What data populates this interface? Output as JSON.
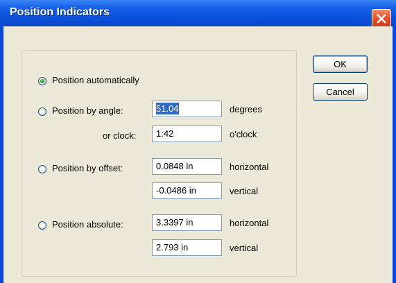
{
  "window": {
    "title": "Position Indicators",
    "close_icon": "close-icon"
  },
  "buttons": {
    "ok": "OK",
    "cancel": "Cancel"
  },
  "options": {
    "auto": {
      "label": "Position automatically",
      "selected": true
    },
    "angle": {
      "label": "Position by angle:",
      "angle_value": "51.04",
      "angle_unit": "degrees",
      "clock_label": "or clock:",
      "clock_value": "1:42",
      "clock_unit": "o'clock"
    },
    "offset": {
      "label": "Position by offset:",
      "horizontal_value": "0.0848 in",
      "horizontal_unit": "horizontal",
      "vertical_value": "-0.0486 in",
      "vertical_unit": "vertical"
    },
    "absolute": {
      "label": "Position absolute:",
      "horizontal_value": "3.3397 in",
      "horizontal_unit": "horizontal",
      "vertical_value": "2.793 in",
      "vertical_unit": "vertical"
    }
  },
  "colors": {
    "titlebar": "#0a4fd8",
    "client": "#ece9d8",
    "selection": "#316ac5",
    "close": "#e0502c"
  }
}
